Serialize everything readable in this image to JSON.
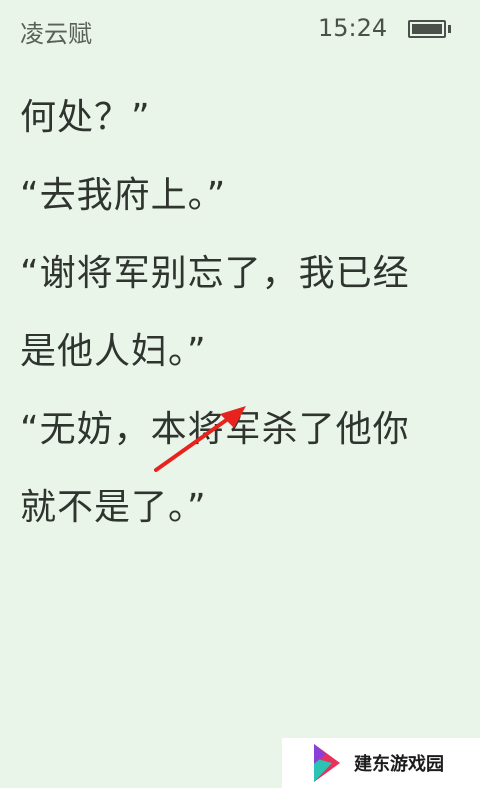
{
  "status_bar": {
    "book_title": "凌云赋",
    "time": "15:24",
    "battery_level": 0.9
  },
  "reader": {
    "lines": [
      "何处？”",
      "“去我府上。”",
      "“谢将军别忘了，我已经",
      "是他人妇。”",
      "“无妨，本将军杀了他你",
      "就不是了。”"
    ]
  },
  "annotation": {
    "arrow_color": "#e8231e"
  },
  "watermark": {
    "text": "建东游戏园"
  }
}
